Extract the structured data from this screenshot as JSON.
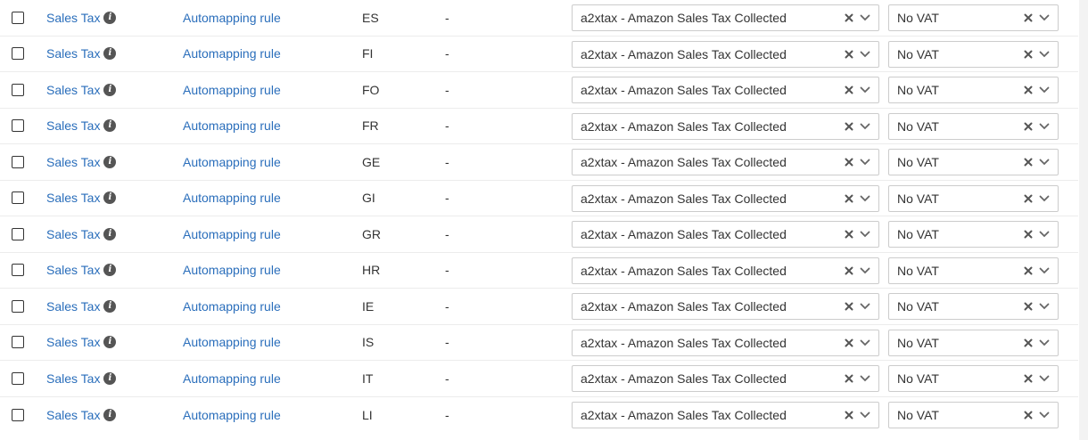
{
  "rows": [
    {
      "type": "Sales Tax",
      "rule": "Automapping rule",
      "code": "ES",
      "dash": "-",
      "account": "a2xtax - Amazon Sales Tax Collected",
      "tax_rate": "No VAT"
    },
    {
      "type": "Sales Tax",
      "rule": "Automapping rule",
      "code": "FI",
      "dash": "-",
      "account": "a2xtax - Amazon Sales Tax Collected",
      "tax_rate": "No VAT"
    },
    {
      "type": "Sales Tax",
      "rule": "Automapping rule",
      "code": "FO",
      "dash": "-",
      "account": "a2xtax - Amazon Sales Tax Collected",
      "tax_rate": "No VAT"
    },
    {
      "type": "Sales Tax",
      "rule": "Automapping rule",
      "code": "FR",
      "dash": "-",
      "account": "a2xtax - Amazon Sales Tax Collected",
      "tax_rate": "No VAT"
    },
    {
      "type": "Sales Tax",
      "rule": "Automapping rule",
      "code": "GE",
      "dash": "-",
      "account": "a2xtax - Amazon Sales Tax Collected",
      "tax_rate": "No VAT"
    },
    {
      "type": "Sales Tax",
      "rule": "Automapping rule",
      "code": "GI",
      "dash": "-",
      "account": "a2xtax - Amazon Sales Tax Collected",
      "tax_rate": "No VAT"
    },
    {
      "type": "Sales Tax",
      "rule": "Automapping rule",
      "code": "GR",
      "dash": "-",
      "account": "a2xtax - Amazon Sales Tax Collected",
      "tax_rate": "No VAT"
    },
    {
      "type": "Sales Tax",
      "rule": "Automapping rule",
      "code": "HR",
      "dash": "-",
      "account": "a2xtax - Amazon Sales Tax Collected",
      "tax_rate": "No VAT"
    },
    {
      "type": "Sales Tax",
      "rule": "Automapping rule",
      "code": "IE",
      "dash": "-",
      "account": "a2xtax - Amazon Sales Tax Collected",
      "tax_rate": "No VAT"
    },
    {
      "type": "Sales Tax",
      "rule": "Automapping rule",
      "code": "IS",
      "dash": "-",
      "account": "a2xtax - Amazon Sales Tax Collected",
      "tax_rate": "No VAT"
    },
    {
      "type": "Sales Tax",
      "rule": "Automapping rule",
      "code": "IT",
      "dash": "-",
      "account": "a2xtax - Amazon Sales Tax Collected",
      "tax_rate": "No VAT"
    },
    {
      "type": "Sales Tax",
      "rule": "Automapping rule",
      "code": "LI",
      "dash": "-",
      "account": "a2xtax - Amazon Sales Tax Collected",
      "tax_rate": "No VAT"
    }
  ],
  "icons": {
    "info": "info-icon",
    "clear": "close-icon",
    "dropdown": "chevron-down-icon"
  },
  "colors": {
    "link": "#2a6ebb",
    "text": "#333333",
    "border": "#cccccc",
    "icon": "#555555"
  }
}
